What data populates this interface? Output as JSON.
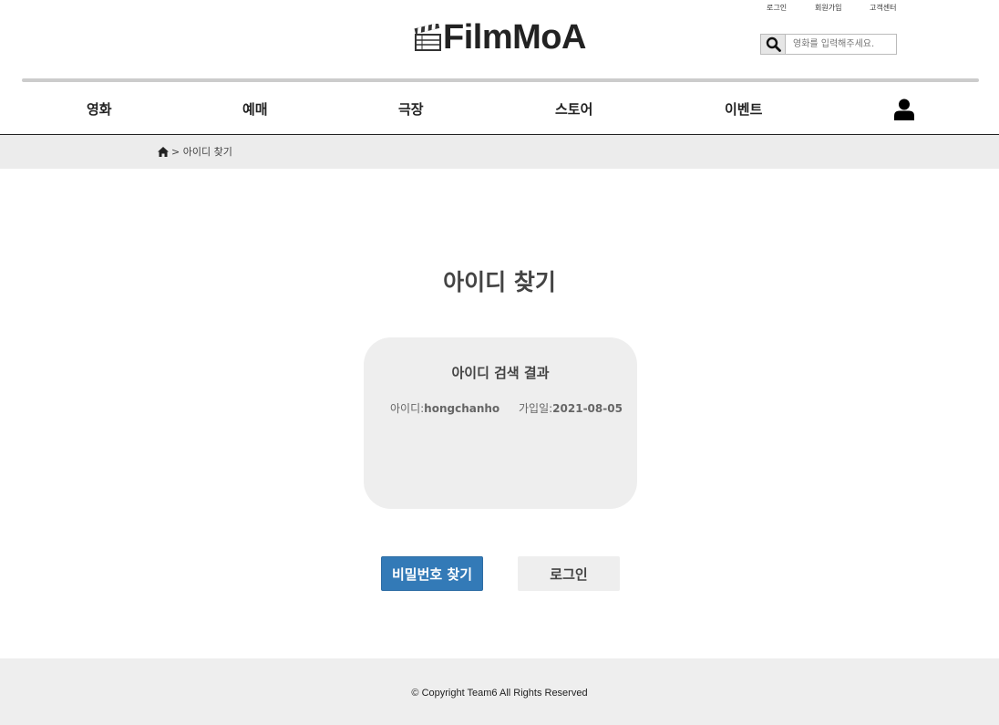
{
  "header": {
    "top_links": {
      "login": "로그인",
      "signup": "회원가입",
      "support": "고객센터"
    },
    "logo_text": "FilmMoA",
    "logo_icon": "clapperboard-icon",
    "search": {
      "placeholder": "영화를 입력해주세요.",
      "icon": "search-icon"
    }
  },
  "nav": {
    "items": [
      {
        "label": "영화"
      },
      {
        "label": "예매"
      },
      {
        "label": "극장"
      },
      {
        "label": "스토어"
      },
      {
        "label": "이벤트"
      }
    ],
    "user_icon": "user-icon"
  },
  "breadcrumb": {
    "home_icon": "home-icon",
    "text": "> 아이디 찾기"
  },
  "main": {
    "title": "아이디 찾기",
    "result_card": {
      "title": "아이디 검색 결과",
      "id_label": "아이디:",
      "id_value": "hongchanho",
      "joined_label": "가입일:",
      "joined_value": "2021-08-05"
    },
    "buttons": {
      "find_password": "비밀번호 찾기",
      "login": "로그인"
    }
  },
  "footer": {
    "copyright": "© Copyright Team6 All Rights Reserved"
  },
  "colors": {
    "primary_button": "#337ab7",
    "light_gray": "#eeeeee",
    "divider": "#cccccc"
  }
}
